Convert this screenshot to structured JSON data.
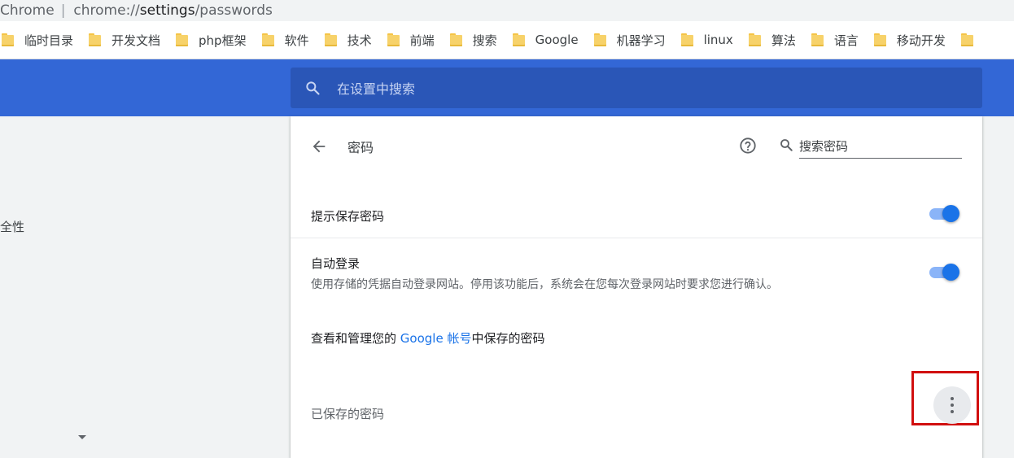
{
  "address_bar": {
    "site": "Chrome",
    "separator": "|",
    "url_prefix": "chrome://",
    "url_host": "settings",
    "url_path": "/passwords"
  },
  "bookmarks": [
    {
      "label": "临时目录",
      "icon": "folder-icon"
    },
    {
      "label": "开发文档",
      "icon": "folder-icon"
    },
    {
      "label": "php框架",
      "icon": "folder-icon"
    },
    {
      "label": "软件",
      "icon": "folder-icon"
    },
    {
      "label": "技术",
      "icon": "folder-icon"
    },
    {
      "label": "前端",
      "icon": "folder-icon"
    },
    {
      "label": "搜索",
      "icon": "folder-icon"
    },
    {
      "label": "Google",
      "icon": "folder-icon"
    },
    {
      "label": "机器学习",
      "icon": "folder-icon"
    },
    {
      "label": "linux",
      "icon": "folder-icon"
    },
    {
      "label": "算法",
      "icon": "folder-icon"
    },
    {
      "label": "语言",
      "icon": "folder-icon"
    },
    {
      "label": "移动开发",
      "icon": "folder-icon"
    },
    {
      "label": "",
      "icon": "folder-icon"
    }
  ],
  "header": {
    "search_placeholder": "在设置中搜索",
    "search_icon": "search-icon"
  },
  "sidebar": {
    "partial_item": "安全性"
  },
  "passwords": {
    "title": "密码",
    "back_icon": "back-arrow-icon",
    "help_icon": "help-icon",
    "search_placeholder": "搜索密码",
    "offer_to_save_label": "提示保存密码",
    "offer_to_save_on": true,
    "auto_signin_label": "自动登录",
    "auto_signin_desc": "使用存储的凭据自动登录网站。停用该功能后，系统会在您每次登录网站时要求您进行确认。",
    "auto_signin_on": true,
    "manage_prefix": "查看和管理您的 ",
    "manage_link": "Google 帐号",
    "manage_suffix": "中保存的密码",
    "saved_header": "已保存的密码",
    "more_icon": "more-vert-icon"
  },
  "colors": {
    "header_blue": "#3367d6",
    "search_box": "#2a56b7",
    "toggle_on": "#1a73e8",
    "highlight_box": "#d10f0f"
  }
}
